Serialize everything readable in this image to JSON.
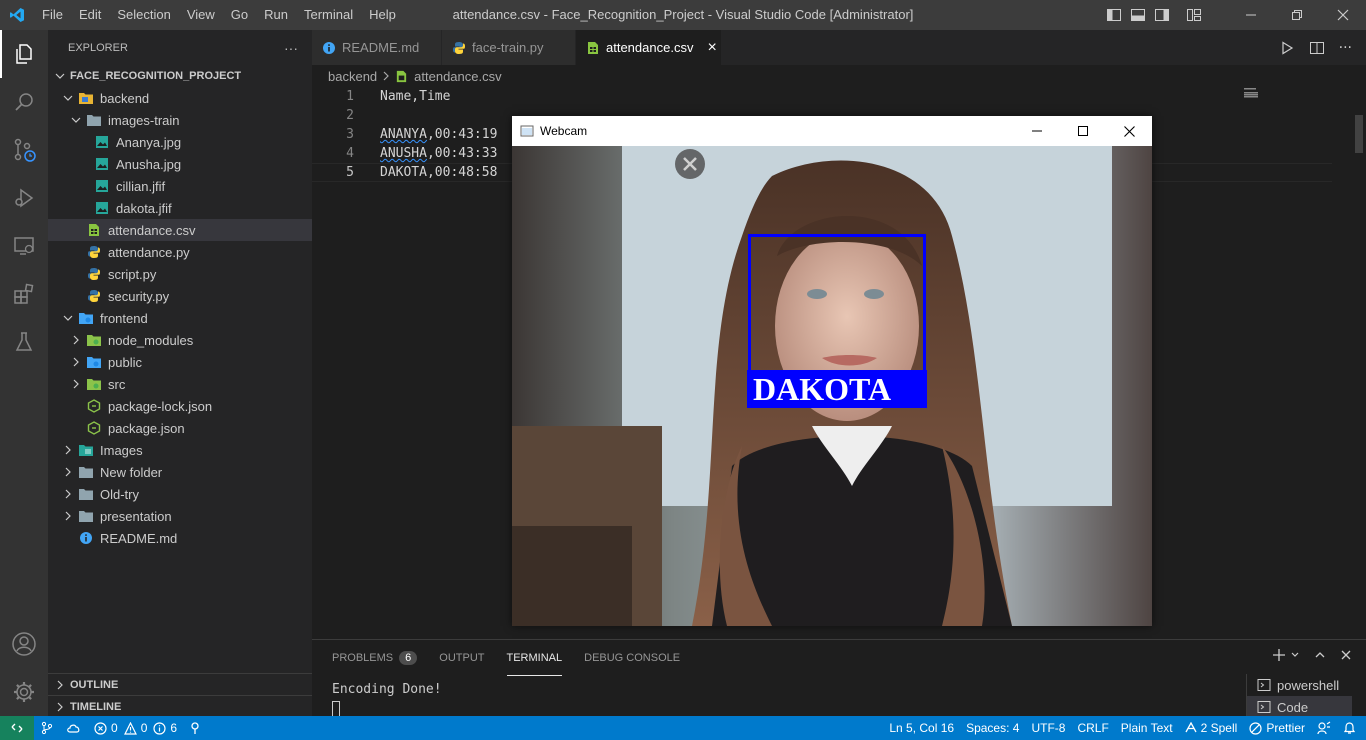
{
  "titlebar": {
    "menu": [
      "File",
      "Edit",
      "Selection",
      "View",
      "Go",
      "Run",
      "Terminal",
      "Help"
    ],
    "window_title": "attendance.csv - Face_Recognition_Project - Visual Studio Code [Administrator]"
  },
  "explorer": {
    "header": "EXPLORER",
    "more": "···",
    "project": "FACE_RECOGNITION_PROJECT",
    "items": [
      {
        "label": "backend",
        "kind": "folder-open",
        "icon": "folder-yellow-icon"
      },
      {
        "label": "images-train",
        "kind": "folder-open",
        "icon": "folder-icon"
      },
      {
        "label": "Ananya.jpg",
        "kind": "file",
        "icon": "image-file-icon"
      },
      {
        "label": "Anusha.jpg",
        "kind": "file",
        "icon": "image-file-icon"
      },
      {
        "label": "cillian.jfif",
        "kind": "file",
        "icon": "image-file-icon"
      },
      {
        "label": "dakota.jfif",
        "kind": "file",
        "icon": "image-file-icon"
      },
      {
        "label": "attendance.csv",
        "kind": "file",
        "icon": "csv-file-icon"
      },
      {
        "label": "attendance.py",
        "kind": "file",
        "icon": "python-file-icon"
      },
      {
        "label": "script.py",
        "kind": "file",
        "icon": "python-file-icon"
      },
      {
        "label": "security.py",
        "kind": "file",
        "icon": "python-file-icon"
      },
      {
        "label": "frontend",
        "kind": "folder-open",
        "icon": "folder-blue-icon"
      },
      {
        "label": "node_modules",
        "kind": "folder",
        "icon": "folder-green-icon"
      },
      {
        "label": "public",
        "kind": "folder",
        "icon": "folder-blue-icon"
      },
      {
        "label": "src",
        "kind": "folder",
        "icon": "folder-green-icon"
      },
      {
        "label": "package-lock.json",
        "kind": "file",
        "icon": "json-file-icon"
      },
      {
        "label": "package.json",
        "kind": "file",
        "icon": "json-file-icon"
      },
      {
        "label": "Images",
        "kind": "folder",
        "icon": "folder-teal-icon"
      },
      {
        "label": "New folder",
        "kind": "folder",
        "icon": "folder-gray-icon"
      },
      {
        "label": "Old-try",
        "kind": "folder",
        "icon": "folder-gray-icon"
      },
      {
        "label": "presentation",
        "kind": "folder",
        "icon": "folder-gray-icon"
      },
      {
        "label": "README.md",
        "kind": "file",
        "icon": "info-file-icon"
      }
    ],
    "outline": "OUTLINE",
    "timeline": "TIMELINE"
  },
  "tabs": [
    {
      "label": "README.md",
      "icon": "info-icon"
    },
    {
      "label": "face-train.py",
      "icon": "python-icon"
    },
    {
      "label": "attendance.csv",
      "icon": "csv-icon",
      "close": "×"
    }
  ],
  "breadcrumb": {
    "folder": "backend",
    "file": "attendance.csv"
  },
  "editor": {
    "line_numbers": [
      "1",
      "2",
      "3",
      "4",
      "5"
    ],
    "lines": [
      "Name,Time",
      "",
      "ANANYA,00:43:19",
      "ANUSHA,00:43:33",
      "DAKOTA,00:48:58"
    ],
    "squiggle_words": [
      "ANANYA",
      "ANUSHA"
    ]
  },
  "webcam": {
    "title": "Webcam",
    "detected_name": "DAKOTA"
  },
  "panel": {
    "tabs": [
      "PROBLEMS",
      "OUTPUT",
      "TERMINAL",
      "DEBUG CONSOLE"
    ],
    "problems_count": "6",
    "terminal_output": "Encoding Done!",
    "terminals": [
      "powershell",
      "Code"
    ]
  },
  "statusbar": {
    "errors": "0",
    "warnings": "0",
    "info": "6",
    "position": "Ln 5, Col 16",
    "spaces": "Spaces: 4",
    "encoding": "UTF-8",
    "eol": "CRLF",
    "language": "Plain Text",
    "spell": "2 Spell",
    "prettier": "Prettier"
  },
  "colors": {
    "accent": "#007acc",
    "remote": "#16825d",
    "facebox": "#0000ff"
  }
}
